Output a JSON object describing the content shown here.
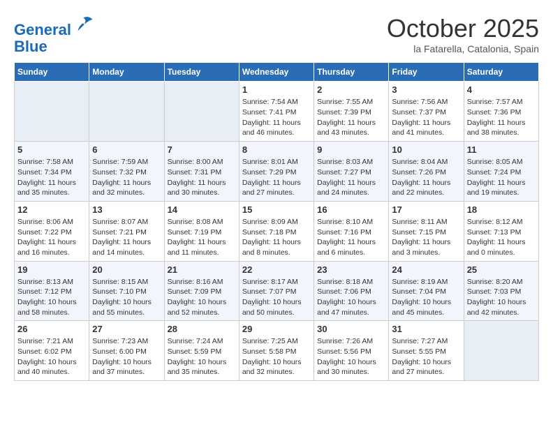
{
  "header": {
    "logo_line1": "General",
    "logo_line2": "Blue",
    "month_title": "October 2025",
    "subtitle": "la Fatarella, Catalonia, Spain"
  },
  "weekdays": [
    "Sunday",
    "Monday",
    "Tuesday",
    "Wednesday",
    "Thursday",
    "Friday",
    "Saturday"
  ],
  "weeks": [
    [
      {
        "day": "",
        "info": ""
      },
      {
        "day": "",
        "info": ""
      },
      {
        "day": "",
        "info": ""
      },
      {
        "day": "1",
        "info": "Sunrise: 7:54 AM\nSunset: 7:41 PM\nDaylight: 11 hours\nand 46 minutes."
      },
      {
        "day": "2",
        "info": "Sunrise: 7:55 AM\nSunset: 7:39 PM\nDaylight: 11 hours\nand 43 minutes."
      },
      {
        "day": "3",
        "info": "Sunrise: 7:56 AM\nSunset: 7:37 PM\nDaylight: 11 hours\nand 41 minutes."
      },
      {
        "day": "4",
        "info": "Sunrise: 7:57 AM\nSunset: 7:36 PM\nDaylight: 11 hours\nand 38 minutes."
      }
    ],
    [
      {
        "day": "5",
        "info": "Sunrise: 7:58 AM\nSunset: 7:34 PM\nDaylight: 11 hours\nand 35 minutes."
      },
      {
        "day": "6",
        "info": "Sunrise: 7:59 AM\nSunset: 7:32 PM\nDaylight: 11 hours\nand 32 minutes."
      },
      {
        "day": "7",
        "info": "Sunrise: 8:00 AM\nSunset: 7:31 PM\nDaylight: 11 hours\nand 30 minutes."
      },
      {
        "day": "8",
        "info": "Sunrise: 8:01 AM\nSunset: 7:29 PM\nDaylight: 11 hours\nand 27 minutes."
      },
      {
        "day": "9",
        "info": "Sunrise: 8:03 AM\nSunset: 7:27 PM\nDaylight: 11 hours\nand 24 minutes."
      },
      {
        "day": "10",
        "info": "Sunrise: 8:04 AM\nSunset: 7:26 PM\nDaylight: 11 hours\nand 22 minutes."
      },
      {
        "day": "11",
        "info": "Sunrise: 8:05 AM\nSunset: 7:24 PM\nDaylight: 11 hours\nand 19 minutes."
      }
    ],
    [
      {
        "day": "12",
        "info": "Sunrise: 8:06 AM\nSunset: 7:22 PM\nDaylight: 11 hours\nand 16 minutes."
      },
      {
        "day": "13",
        "info": "Sunrise: 8:07 AM\nSunset: 7:21 PM\nDaylight: 11 hours\nand 14 minutes."
      },
      {
        "day": "14",
        "info": "Sunrise: 8:08 AM\nSunset: 7:19 PM\nDaylight: 11 hours\nand 11 minutes."
      },
      {
        "day": "15",
        "info": "Sunrise: 8:09 AM\nSunset: 7:18 PM\nDaylight: 11 hours\nand 8 minutes."
      },
      {
        "day": "16",
        "info": "Sunrise: 8:10 AM\nSunset: 7:16 PM\nDaylight: 11 hours\nand 6 minutes."
      },
      {
        "day": "17",
        "info": "Sunrise: 8:11 AM\nSunset: 7:15 PM\nDaylight: 11 hours\nand 3 minutes."
      },
      {
        "day": "18",
        "info": "Sunrise: 8:12 AM\nSunset: 7:13 PM\nDaylight: 11 hours\nand 0 minutes."
      }
    ],
    [
      {
        "day": "19",
        "info": "Sunrise: 8:13 AM\nSunset: 7:12 PM\nDaylight: 10 hours\nand 58 minutes."
      },
      {
        "day": "20",
        "info": "Sunrise: 8:15 AM\nSunset: 7:10 PM\nDaylight: 10 hours\nand 55 minutes."
      },
      {
        "day": "21",
        "info": "Sunrise: 8:16 AM\nSunset: 7:09 PM\nDaylight: 10 hours\nand 52 minutes."
      },
      {
        "day": "22",
        "info": "Sunrise: 8:17 AM\nSunset: 7:07 PM\nDaylight: 10 hours\nand 50 minutes."
      },
      {
        "day": "23",
        "info": "Sunrise: 8:18 AM\nSunset: 7:06 PM\nDaylight: 10 hours\nand 47 minutes."
      },
      {
        "day": "24",
        "info": "Sunrise: 8:19 AM\nSunset: 7:04 PM\nDaylight: 10 hours\nand 45 minutes."
      },
      {
        "day": "25",
        "info": "Sunrise: 8:20 AM\nSunset: 7:03 PM\nDaylight: 10 hours\nand 42 minutes."
      }
    ],
    [
      {
        "day": "26",
        "info": "Sunrise: 7:21 AM\nSunset: 6:02 PM\nDaylight: 10 hours\nand 40 minutes."
      },
      {
        "day": "27",
        "info": "Sunrise: 7:23 AM\nSunset: 6:00 PM\nDaylight: 10 hours\nand 37 minutes."
      },
      {
        "day": "28",
        "info": "Sunrise: 7:24 AM\nSunset: 5:59 PM\nDaylight: 10 hours\nand 35 minutes."
      },
      {
        "day": "29",
        "info": "Sunrise: 7:25 AM\nSunset: 5:58 PM\nDaylight: 10 hours\nand 32 minutes."
      },
      {
        "day": "30",
        "info": "Sunrise: 7:26 AM\nSunset: 5:56 PM\nDaylight: 10 hours\nand 30 minutes."
      },
      {
        "day": "31",
        "info": "Sunrise: 7:27 AM\nSunset: 5:55 PM\nDaylight: 10 hours\nand 27 minutes."
      },
      {
        "day": "",
        "info": ""
      }
    ]
  ]
}
